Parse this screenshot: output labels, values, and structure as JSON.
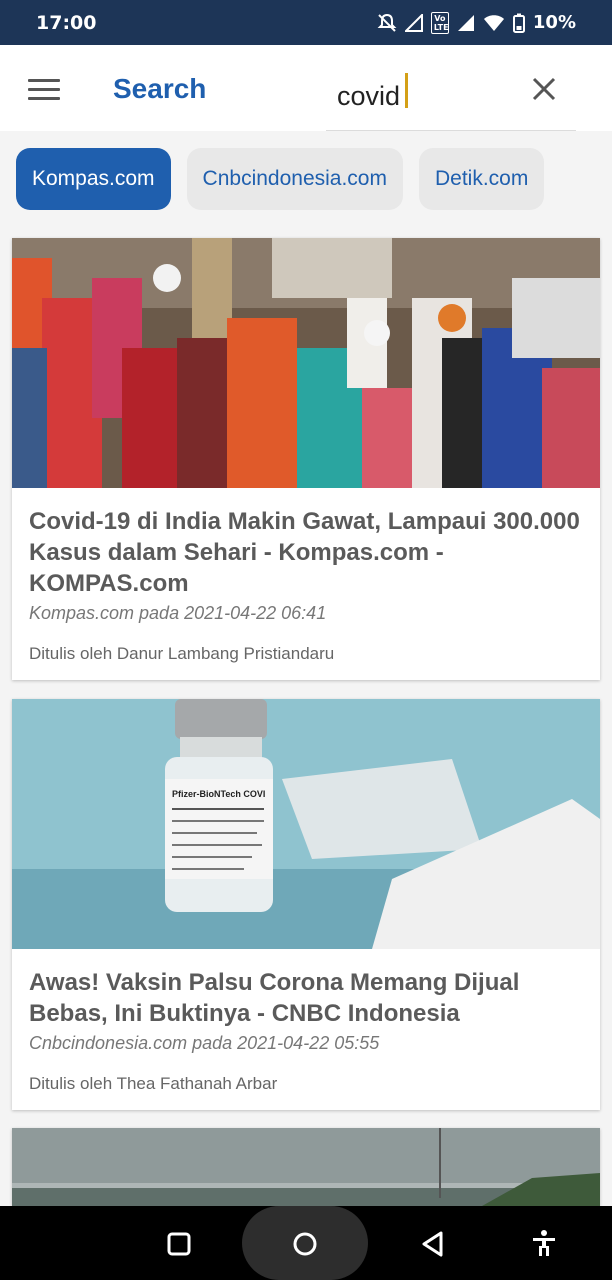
{
  "status_bar": {
    "time": "17:00",
    "battery": "10%",
    "network_badge": "Vo LTE"
  },
  "appbar": {
    "title": "Search",
    "query": "covid"
  },
  "sources": [
    {
      "label": "Kompas.com",
      "active": true
    },
    {
      "label": "Cnbcindonesia.com",
      "active": false
    },
    {
      "label": "Detik.com",
      "active": false
    }
  ],
  "articles": [
    {
      "title": "Covid-19 di India Makin Gawat, Lampaui 300.000 Kasus dalam Sehari - Kompas.com - KOMPAS.com",
      "meta": "Kompas.com pada 2021-04-22 06:41",
      "author": "Ditulis oleh Danur Lambang Pristiandaru"
    },
    {
      "title": "Awas! Vaksin Palsu Corona Memang Dijual Bebas, Ini Buktinya - CNBC Indonesia",
      "meta": "Cnbcindonesia.com pada 2021-04-22 05:55",
      "author": "Ditulis oleh Thea Fathanah Arbar",
      "vial_label": "Pfizer-BioNTech COVI"
    }
  ],
  "colors": {
    "accent": "#1f5fae",
    "status_bar": "#1d3557",
    "cursor": "#d4a017"
  }
}
